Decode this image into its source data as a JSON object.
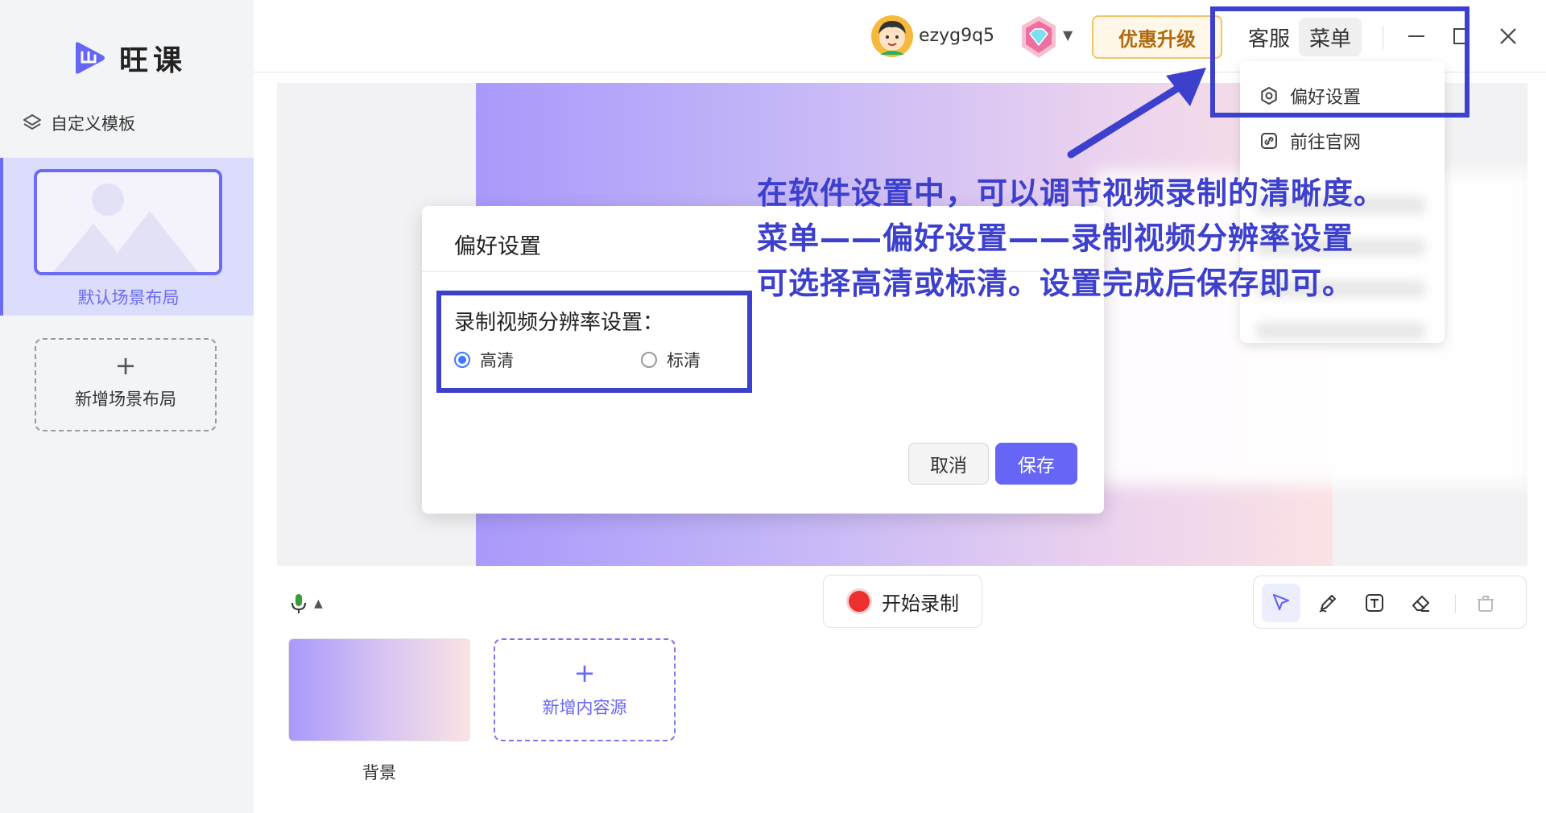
{
  "app": {
    "name": "旺课"
  },
  "colors": {
    "accent": "#6665f5",
    "annotation": "#3d40cc",
    "record": "#ec2f2f",
    "upgrade_text": "#b06a10"
  },
  "sidebar": {
    "custom_template": "自定义模板",
    "scenes": [
      {
        "label": "默认场景布局",
        "selected": true
      }
    ],
    "add_scene": {
      "icon": "+",
      "label": "新增场景布局"
    }
  },
  "topbar": {
    "username": "ezyg9q5",
    "upgrade_label": "优惠升级",
    "service_label": "客服",
    "menu_label": "菜单"
  },
  "menu": {
    "items": [
      {
        "icon": "settings-icon",
        "label": "偏好设置"
      },
      {
        "icon": "link-icon",
        "label": "前往官网"
      }
    ]
  },
  "dialog": {
    "title": "偏好设置",
    "resolution_label": "录制视频分辨率设置：",
    "options": [
      {
        "label": "高清",
        "selected": true
      },
      {
        "label": "标清",
        "selected": false
      }
    ],
    "cancel_label": "取消",
    "save_label": "保存"
  },
  "annotation": {
    "lines": [
      "在软件设置中，可以调节视频录制的清晰度。",
      "菜单——偏好设置——录制视频分辨率设置",
      "可选择高清或标清。设置完成后保存即可。"
    ]
  },
  "controls": {
    "record_label": "开始录制"
  },
  "sources": {
    "items": [
      {
        "label": "背景"
      }
    ],
    "add": {
      "icon": "+",
      "label": "新增内容源"
    }
  }
}
